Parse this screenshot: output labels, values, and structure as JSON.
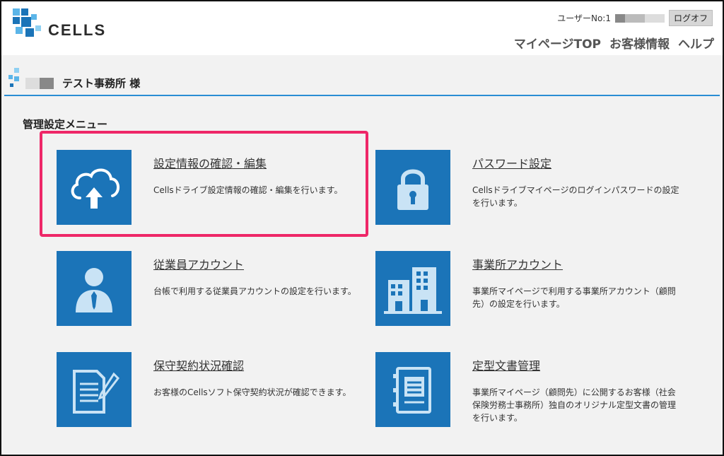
{
  "header": {
    "logo_text": "CELLS",
    "user_label": "ユーザーNo:1",
    "logout_label": "ログオフ",
    "nav": [
      "マイページTOP",
      "お客様情報",
      "ヘルプ"
    ]
  },
  "office": {
    "name": "テスト事務所 様"
  },
  "menu": {
    "title": "管理設定メニュー",
    "items": [
      {
        "title": "設定情報の確認・編集",
        "desc": "Cellsドライブ設定情報の確認・編集を行います。",
        "icon": "cloud-upload-icon"
      },
      {
        "title": "パスワード設定",
        "desc": "Cellsドライブマイページのログインパスワードの設定を行います。",
        "icon": "lock-icon"
      },
      {
        "title": "従業員アカウント",
        "desc": "台帳で利用する従業員アカウントの設定を行います。",
        "icon": "employee-icon"
      },
      {
        "title": "事業所アカウント",
        "desc": "事業所マイページで利用する事業所アカウント（顧問先）の設定を行います。",
        "icon": "building-icon"
      },
      {
        "title": "保守契約状況確認",
        "desc": "お客様のCellsソフト保守契約状況が確認できます。",
        "icon": "document-pen-icon"
      },
      {
        "title": "定型文書管理",
        "desc": "事業所マイページ（顧問先）に公開するお客様（社会保険労務士事務所）独自のオリジナル定型文書の管理を行います。",
        "icon": "binder-document-icon"
      }
    ]
  },
  "colors": {
    "tile": "#1b74b8",
    "accent_line": "#2a8dd4",
    "highlight": "#ee2768"
  }
}
